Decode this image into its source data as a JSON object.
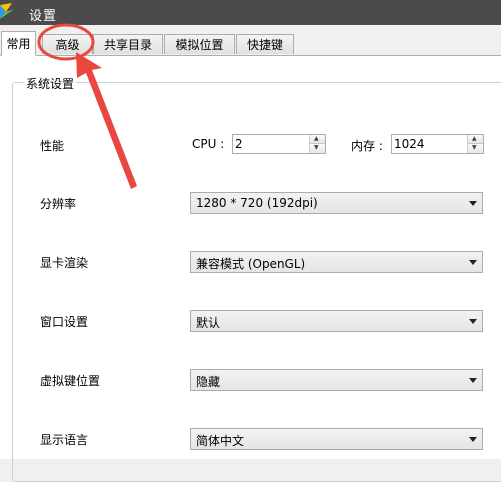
{
  "window": {
    "title": "设置",
    "icon": "app-logo-icon"
  },
  "tabs": [
    {
      "label": "常用"
    },
    {
      "label": "高级"
    },
    {
      "label": "共享目录"
    },
    {
      "label": "模拟位置"
    },
    {
      "label": "快捷键"
    }
  ],
  "group": {
    "title": "系统设置"
  },
  "settings": {
    "performance": {
      "label": "性能",
      "cpu_label": "CPU :",
      "cpu_value": "2",
      "memory_label": "内存 :",
      "memory_value": "1024"
    },
    "resolution": {
      "label": "分辨率",
      "value": "1280 * 720 (192dpi)"
    },
    "graphics": {
      "label": "显卡渲染",
      "value": "兼容模式 (OpenGL)"
    },
    "window": {
      "label": "窗口设置",
      "value": "默认"
    },
    "virtual_keys": {
      "label": "虚拟键位置",
      "value": "隐藏"
    },
    "language": {
      "label": "显示语言",
      "value": "简体中文"
    }
  },
  "annotation": {
    "highlight_color": "#e8483f"
  }
}
